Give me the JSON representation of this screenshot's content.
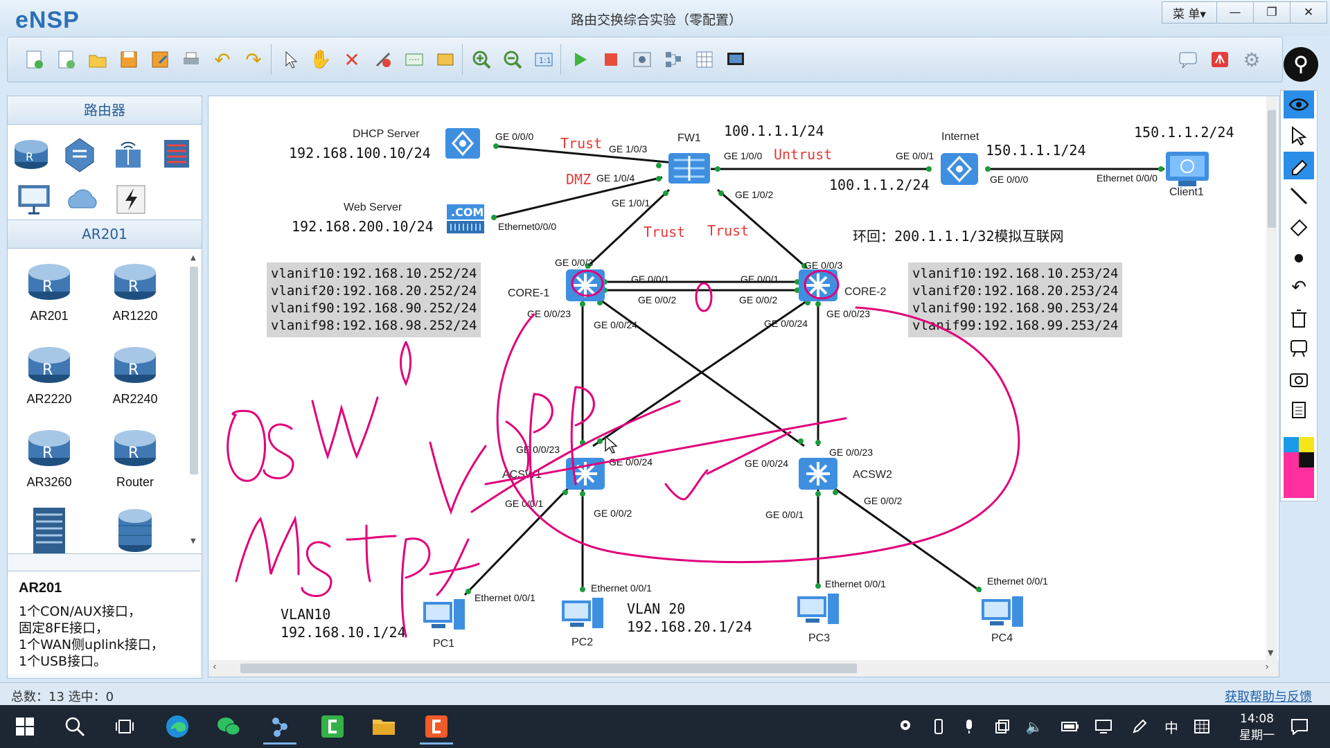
{
  "app": {
    "name": "eNSP",
    "title": "路由交换综合实验（零配置）",
    "menu_label": "菜 单▾",
    "minimize": "—",
    "restore": "❐",
    "close": "✕"
  },
  "left_panel": {
    "category_title": "路由器",
    "sub_title": "AR201",
    "devices": [
      "AR201",
      "AR1220",
      "AR2220",
      "AR2240",
      "AR3260",
      "Router"
    ],
    "description_title": "AR201",
    "description_lines": [
      "1个CON/AUX接口，",
      "固定8FE接口，",
      "1个WAN侧uplink接口，",
      "1个USB接口。"
    ]
  },
  "topology": {
    "devices": {
      "dhcp": "DHCP Server",
      "web": "Web Server",
      "fw1": "FW1",
      "internet": "Internet",
      "client1": "Client1",
      "core1": "CORE-1",
      "core2": "CORE-2",
      "acsw1": "ACSW1",
      "acsw2": "ACSW2",
      "pc1": "PC1",
      "pc2": "PC2",
      "pc3": "PC3",
      "pc4": "PC4"
    },
    "ips": {
      "dhcp": "192.168.100.10/24",
      "web": "192.168.200.10/24",
      "fw_up": "100.1.1.1/24",
      "internet_left": "100.1.1.2/24",
      "internet_right": "150.1.1.1/24",
      "client": "150.1.1.2/24",
      "loopback": "环回：200.1.1.1/32模拟互联网",
      "vlan10_name": "VLAN10",
      "vlan10_ip": "192.168.10.1/24",
      "vlan20_name": "VLAN 20",
      "vlan20_ip": "192.168.20.1/24"
    },
    "zones": {
      "trust1": "Trust",
      "dmz": "DMZ",
      "untrust": "Untrust",
      "trust2": "Trust",
      "trust3": "Trust"
    },
    "ports": {
      "dhcp_ge000": "GE 0/0/0",
      "fw_ge103": "GE 1/0/3",
      "fw_ge104": "GE 1/0/4",
      "fw_ge100": "GE 1/0/0",
      "fw_ge101": "GE 1/0/1",
      "fw_ge102": "GE 1/0/2",
      "web_eth000": "Ethernet0/0/0",
      "inet_ge001": "GE 0/0/1",
      "inet_ge000": "GE 0/0/0",
      "client_eth000": "Ethernet 0/0/0",
      "c1_ge003": "GE 0/0/3",
      "c1_ge001": "GE 0/0/1",
      "c1_ge002": "GE 0/0/2",
      "c1_ge0023": "GE 0/0/23",
      "c1_ge0024": "GE 0/0/24",
      "c2_ge003": "GE 0/0/3",
      "c2_ge001": "GE 0/0/1",
      "c2_ge002": "GE 0/0/2",
      "c2_ge0023": "GE 0/0/23",
      "c2_ge0024": "GE 0/0/24",
      "a1_ge0023": "GE 0/0/23",
      "a1_ge0024": "GE 0/0/24",
      "a1_ge001": "GE 0/0/1",
      "a1_ge002": "GE 0/0/2",
      "a2_ge0024": "GE 0/0/24",
      "a2_ge0023": "GE 0/0/23",
      "a2_ge001": "GE 0/0/1",
      "a2_ge002": "GE 0/0/2",
      "pc1_eth": "Ethernet 0/0/1",
      "pc2_eth": "Ethernet 0/0/1",
      "pc3_eth": "Ethernet 0/0/1",
      "pc4_eth": "Ethernet 0/0/1"
    },
    "core1_box": "vlanif10:192.168.10.252/24\nvlanif20:192.168.20.252/24\nvlanif90:192.168.90.252/24\nvlanif98:192.168.98.252/24",
    "core2_box": "vlanif10:192.168.10.253/24\nvlanif20:192.168.20.253/24\nvlanif90:192.168.90.253/24\nvlanif99:192.168.99.253/24"
  },
  "status": {
    "left": "总数：13  选中：0",
    "right": "获取帮助与反馈"
  },
  "taskbar": {
    "ime": "中",
    "time": "14:08",
    "day": "星期一"
  },
  "colors": {
    "accent": "#2c6fb5",
    "annotation": "#e0007a",
    "zone_red": "#e53935"
  }
}
